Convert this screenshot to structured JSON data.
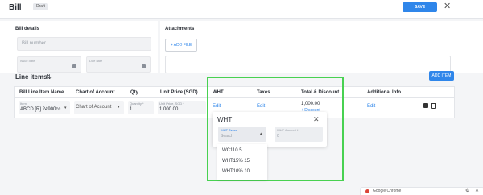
{
  "header": {
    "title": "Bill",
    "status_badge": "Draft",
    "save_label": "SAVE",
    "close_icon": "close-icon"
  },
  "bill_details": {
    "section_label": "Bill details",
    "bill_number_placeholder": "Bill number",
    "issue_date_label": "Issue date",
    "due_date_label": "Due date"
  },
  "attachments": {
    "section_label": "Attachments",
    "add_file_label": "+ ADD FILE"
  },
  "line_items": {
    "title": "Line items",
    "add_item_label": "ADD ITEM",
    "columns": [
      "Bill Line Item Name",
      "Chart of Account",
      "Qty",
      "Unit Price (SGD)",
      "WHT",
      "Taxes",
      "Total & Discount",
      "Additional Info"
    ],
    "row": {
      "item_label": "Item",
      "item_value": "ABCD [R] 24900cc...",
      "account_value": "Chart of Account",
      "quantity_label": "Quantity *",
      "quantity_value": "1",
      "unit_price_label": "Unit Price, SGD *",
      "unit_price_value": "1,000.00",
      "wht_link": "Edit",
      "taxes_link": "Edit",
      "total_value": "1,000.00",
      "discount_link": "+ Discount",
      "additional_link": "Edit"
    }
  },
  "wht_popover": {
    "title": "WHT",
    "wht_taxes_label": "WHT Taxes",
    "wht_taxes_placeholder": "Search",
    "wht_amount_label": "WHT Amount *",
    "wht_amount_value": "0",
    "options": [
      "WC110 5",
      "WHT15% 15",
      "WHT10% 10"
    ]
  },
  "notification": {
    "app_name": "Google Chrome"
  },
  "colors": {
    "accent": "#2f86ea",
    "highlight": "#48d151"
  }
}
